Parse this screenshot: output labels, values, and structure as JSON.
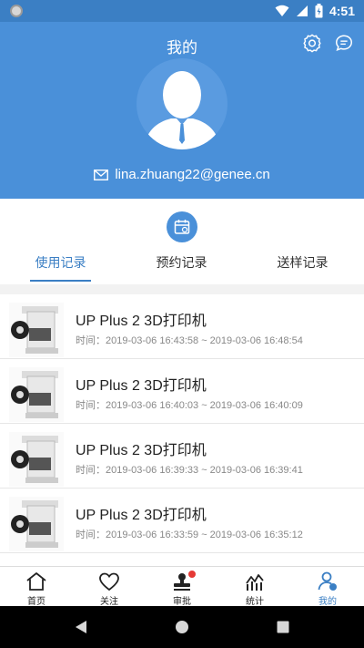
{
  "status_bar": {
    "time": "4:51"
  },
  "header": {
    "title": "我的",
    "email": "lina.zhuang22@genee.cn",
    "icons": {
      "settings": "gear-icon",
      "message": "chat-bubble-icon",
      "email": "envelope-icon",
      "avatar": "person-silhouette-icon"
    }
  },
  "tabs": [
    {
      "label": "使用记录",
      "active": true
    },
    {
      "label": "预约记录",
      "active": false
    },
    {
      "label": "送样记录",
      "active": false
    }
  ],
  "records": [
    {
      "title": "UP Plus 2 3D打印机",
      "time": "时间：2019-03-06 16:43:58 ~ 2019-03-06 16:48:54"
    },
    {
      "title": "UP Plus 2 3D打印机",
      "time": "时间：2019-03-06 16:40:03 ~ 2019-03-06 16:40:09"
    },
    {
      "title": "UP Plus 2 3D打印机",
      "time": "时间：2019-03-06 16:39:33 ~ 2019-03-06 16:39:41"
    },
    {
      "title": "UP Plus 2 3D打印机",
      "time": "时间：2019-03-06 16:33:59 ~ 2019-03-06 16:35:12"
    }
  ],
  "bottom_nav": [
    {
      "label": "首页",
      "icon": "home-icon"
    },
    {
      "label": "关注",
      "icon": "heart-icon"
    },
    {
      "label": "审批",
      "icon": "stamp-icon",
      "badge": true
    },
    {
      "label": "统计",
      "icon": "chart-icon"
    },
    {
      "label": "我的",
      "icon": "user-icon",
      "active": true
    }
  ],
  "colors": {
    "primary": "#4a90d9",
    "accent": "#3b7fc4",
    "badge": "#e53935"
  }
}
